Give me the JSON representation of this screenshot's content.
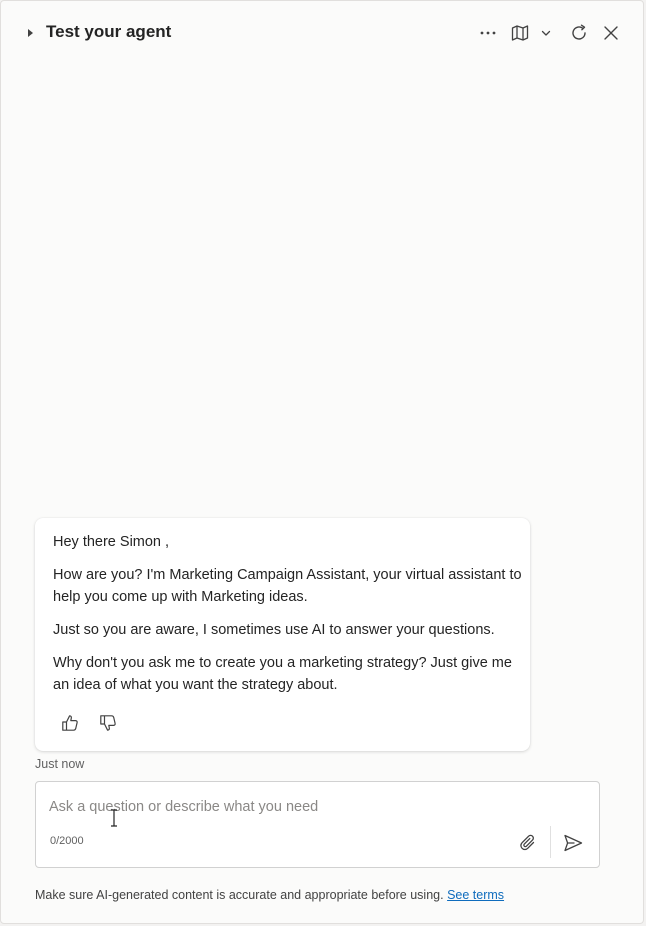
{
  "header": {
    "title": "Test your agent",
    "icons": [
      "caret-right-icon",
      "more-icon",
      "map-icon",
      "chevron-down-icon",
      "refresh-icon",
      "close-icon"
    ]
  },
  "chat": {
    "messages": [
      "Hey there Simon ,",
      "How are you? I'm Marketing Campaign Assistant, your virtual assistant to help you come up with Marketing ideas.",
      "Just so you are aware, I sometimes use AI to answer your questions.",
      "Why don't you ask me to create you a marketing strategy? Just give me an idea of what you want the strategy about."
    ],
    "timestamp": "Just now"
  },
  "composer": {
    "placeholder": "Ask a question or describe what you need",
    "value": "",
    "counter": "0/2000"
  },
  "footer": {
    "disclaimer": "Make sure AI-generated content is accurate and appropriate before using.",
    "link_label": "See terms"
  },
  "colors": {
    "panel_bg": "#fbfbfa",
    "link": "#0f6cbd",
    "text": "#242424"
  }
}
